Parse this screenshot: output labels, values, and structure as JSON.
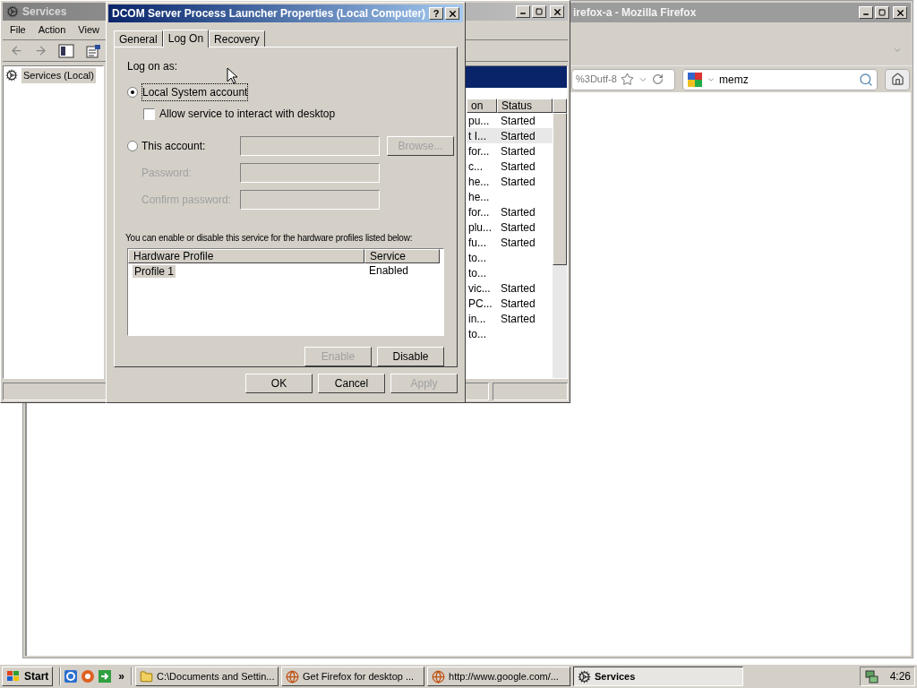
{
  "firefox": {
    "title": "irefox-a - Mozilla Firefox",
    "url": "%3Dutf-8",
    "search": {
      "value": "memz"
    }
  },
  "services": {
    "title": "Services",
    "menu": [
      "File",
      "Action",
      "View"
    ],
    "tree": [
      {
        "label": "Services (Local)",
        "selected": true
      }
    ],
    "list": {
      "columns": [
        "on",
        "Status"
      ],
      "rows": [
        {
          "description": "pu...",
          "status": "Started",
          "selected": false
        },
        {
          "description": "t I...",
          "status": "Started",
          "selected": true
        },
        {
          "description": "for...",
          "status": "Started",
          "selected": false
        },
        {
          "description": "c...",
          "status": "Started",
          "selected": false
        },
        {
          "description": "he...",
          "status": "Started",
          "selected": false
        },
        {
          "description": "he...",
          "selected": false
        },
        {
          "description": "for...",
          "status": "Started",
          "selected": false
        },
        {
          "description": "plu...",
          "status": "Started",
          "selected": false
        },
        {
          "description": "fu...",
          "status": "Started",
          "selected": false
        },
        {
          "description": "to...",
          "selected": false
        },
        {
          "description": "to...",
          "selected": false
        },
        {
          "description": "vic...",
          "status": "Started",
          "selected": false
        },
        {
          "description": "PC...",
          "status": "Started",
          "selected": false
        },
        {
          "description": "in...",
          "status": "Started",
          "selected": false
        },
        {
          "description": "to...",
          "selected": false
        }
      ]
    }
  },
  "dialog": {
    "title": "DCOM Server Process Launcher Properties (Local Computer)",
    "help": "?",
    "tabs": [
      {
        "label": "General",
        "selected": false
      },
      {
        "label": "Log On",
        "selected": true
      },
      {
        "label": "Recovery",
        "selected": false
      }
    ],
    "logon_label": "Log on as:",
    "options": [
      {
        "label": "Local System account",
        "selected": true
      },
      {
        "label": "This account:",
        "selected": false
      }
    ],
    "interact": {
      "label": "Allow service to interact with desktop",
      "checked": false
    },
    "browse": {
      "label": "Browse...",
      "disabled": true
    },
    "fields": [
      {
        "label": "Password:",
        "disabled": true
      },
      {
        "label": "Confirm password:",
        "disabled": true
      }
    ],
    "profiles_note": "You can enable or disable this service for the hardware profiles listed below:",
    "profiles": {
      "columns": [
        "Hardware Profile",
        "Service"
      ],
      "rows": [
        {
          "profile": "Profile 1",
          "service": "Enabled",
          "selected": true
        }
      ]
    },
    "profile_buttons": [
      {
        "label": "Enable",
        "disabled": true
      },
      {
        "label": "Disable",
        "disabled": false
      }
    ],
    "footer_buttons": [
      {
        "label": "OK",
        "disabled": false
      },
      {
        "label": "Cancel",
        "disabled": false
      },
      {
        "label": "Apply",
        "disabled": true
      }
    ]
  },
  "taskbar": {
    "start": "Start",
    "more": "»",
    "tasks": [
      {
        "label": "C:\\Documents and Settin...",
        "kind": "folder",
        "selected": false
      },
      {
        "label": "Get Firefox for desktop ...",
        "kind": "browser",
        "selected": false
      },
      {
        "label": "http://www.google.com/...",
        "kind": "browser",
        "selected": false
      },
      {
        "label": "Services",
        "kind": "gear",
        "selected": true
      }
    ],
    "clock": "4:26"
  }
}
